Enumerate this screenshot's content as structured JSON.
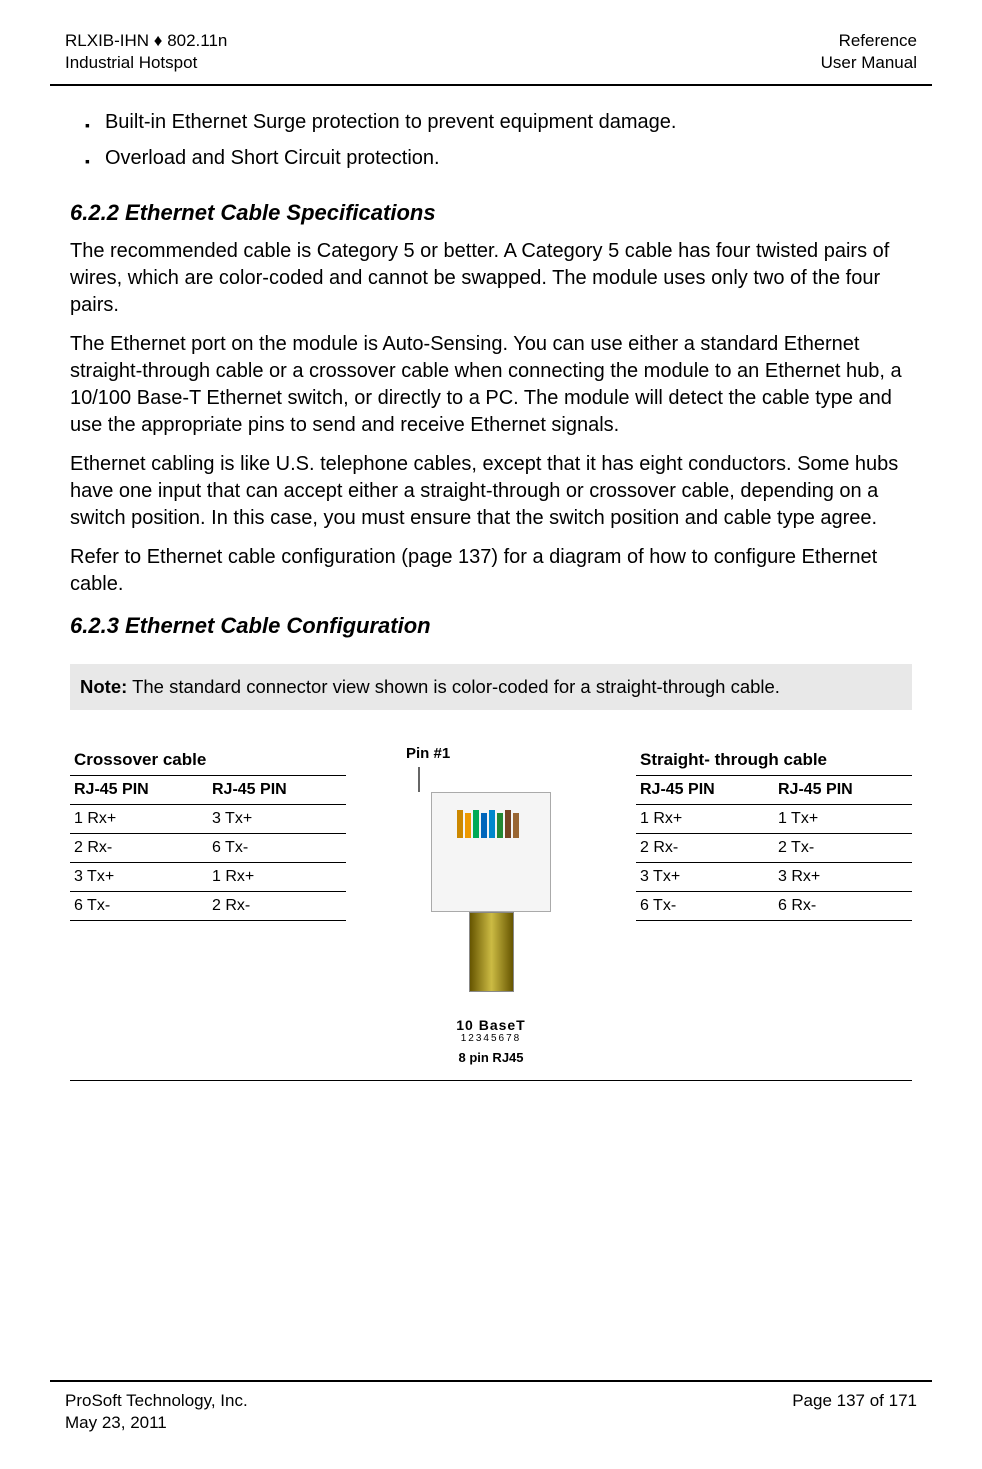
{
  "header": {
    "left_line1": "RLXIB-IHN ♦ 802.11n",
    "left_line2": "Industrial Hotspot",
    "right_line1": "Reference",
    "right_line2": "User Manual"
  },
  "bullets": {
    "item1": "Built-in Ethernet Surge protection to prevent equipment damage.",
    "item2": "Overload and Short Circuit protection."
  },
  "section622": {
    "heading": "6.2.2   Ethernet Cable Specifications",
    "para1": "The recommended cable is Category 5 or better. A Category 5 cable has four twisted pairs of wires, which are color-coded and cannot be swapped. The module uses only two of the four pairs.",
    "para2": "The Ethernet port on the module is Auto-Sensing. You can use either a standard Ethernet straight-through cable or a crossover cable when connecting the module to an Ethernet hub, a 10/100 Base-T Ethernet switch, or directly to a PC. The module will detect the cable type and use the appropriate pins to send and receive Ethernet signals.",
    "para3": "Ethernet cabling is like U.S. telephone cables, except that it has eight conductors. Some hubs have one input that can accept either a straight-through or crossover cable, depending on a switch position. In this case, you must ensure that the switch position and cable type agree.",
    "para4": "Refer to Ethernet cable configuration (page 137) for a diagram of how to configure Ethernet cable."
  },
  "section623": {
    "heading": "6.2.3   Ethernet Cable Configuration"
  },
  "note": {
    "label": "Note:",
    "text": " The standard connector view shown is color-coded for a straight-through cable."
  },
  "tables": {
    "crossover": {
      "title": "Crossover cable",
      "col1_header": "RJ-45 PIN",
      "col2_header": "RJ-45 PIN",
      "rows": [
        {
          "c1": "1 Rx+",
          "c2": "3 Tx+"
        },
        {
          "c1": "2 Rx-",
          "c2": "6 Tx-"
        },
        {
          "c1": "3 Tx+",
          "c2": "1 Rx+"
        },
        {
          "c1": "6 Tx-",
          "c2": "2 Rx-"
        }
      ]
    },
    "straight": {
      "title": "Straight- through cable",
      "col1_header": "RJ-45 PIN",
      "col2_header": "RJ-45 PIN",
      "rows": [
        {
          "c1": "1 Rx+",
          "c2": "1 Tx+"
        },
        {
          "c1": "2 Rx-",
          "c2": "2 Tx-"
        },
        {
          "c1": "3 Tx+",
          "c2": "3 Rx+"
        },
        {
          "c1": "6 Tx-",
          "c2": "6 Rx-"
        }
      ]
    }
  },
  "diagram": {
    "pin_label": "Pin #1",
    "bottom_label1": "10 BaseT",
    "bottom_sub": "12345678",
    "bottom_label2": "8 pin RJ45"
  },
  "footer": {
    "left_line1": "ProSoft Technology, Inc.",
    "left_line2": "May 23, 2011",
    "right_line1": "Page 137 of 171"
  }
}
